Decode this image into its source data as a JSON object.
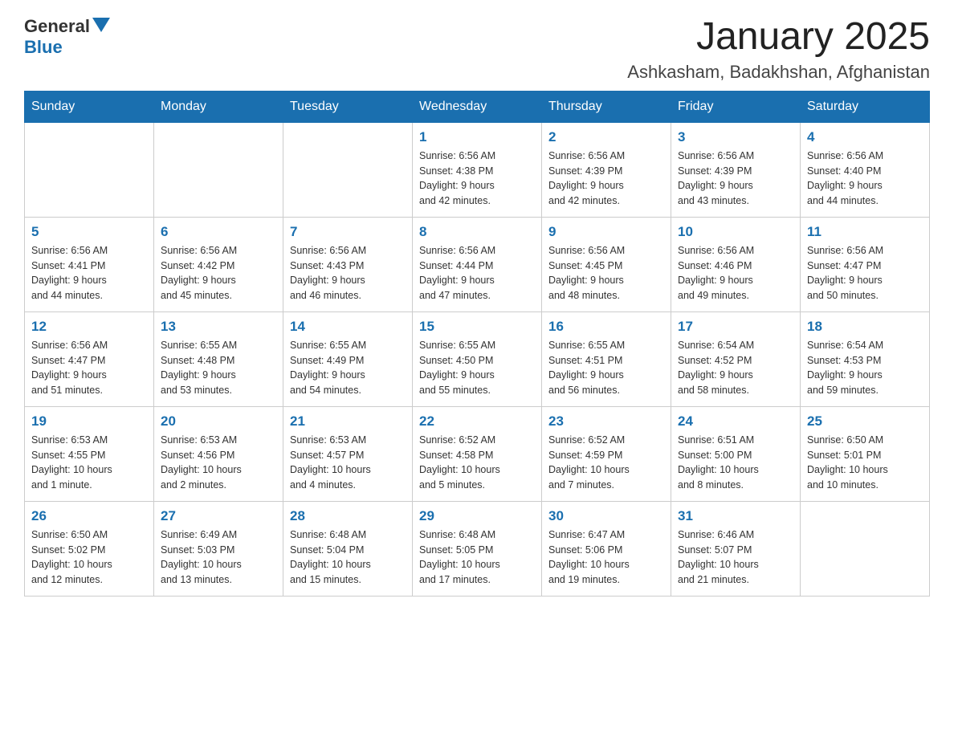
{
  "header": {
    "logo": {
      "general": "General",
      "blue": "Blue"
    },
    "title": "January 2025",
    "location": "Ashkasham, Badakhshan, Afghanistan"
  },
  "days_of_week": [
    "Sunday",
    "Monday",
    "Tuesday",
    "Wednesday",
    "Thursday",
    "Friday",
    "Saturday"
  ],
  "weeks": [
    [
      {
        "day": "",
        "info": ""
      },
      {
        "day": "",
        "info": ""
      },
      {
        "day": "",
        "info": ""
      },
      {
        "day": "1",
        "info": "Sunrise: 6:56 AM\nSunset: 4:38 PM\nDaylight: 9 hours\nand 42 minutes."
      },
      {
        "day": "2",
        "info": "Sunrise: 6:56 AM\nSunset: 4:39 PM\nDaylight: 9 hours\nand 42 minutes."
      },
      {
        "day": "3",
        "info": "Sunrise: 6:56 AM\nSunset: 4:39 PM\nDaylight: 9 hours\nand 43 minutes."
      },
      {
        "day": "4",
        "info": "Sunrise: 6:56 AM\nSunset: 4:40 PM\nDaylight: 9 hours\nand 44 minutes."
      }
    ],
    [
      {
        "day": "5",
        "info": "Sunrise: 6:56 AM\nSunset: 4:41 PM\nDaylight: 9 hours\nand 44 minutes."
      },
      {
        "day": "6",
        "info": "Sunrise: 6:56 AM\nSunset: 4:42 PM\nDaylight: 9 hours\nand 45 minutes."
      },
      {
        "day": "7",
        "info": "Sunrise: 6:56 AM\nSunset: 4:43 PM\nDaylight: 9 hours\nand 46 minutes."
      },
      {
        "day": "8",
        "info": "Sunrise: 6:56 AM\nSunset: 4:44 PM\nDaylight: 9 hours\nand 47 minutes."
      },
      {
        "day": "9",
        "info": "Sunrise: 6:56 AM\nSunset: 4:45 PM\nDaylight: 9 hours\nand 48 minutes."
      },
      {
        "day": "10",
        "info": "Sunrise: 6:56 AM\nSunset: 4:46 PM\nDaylight: 9 hours\nand 49 minutes."
      },
      {
        "day": "11",
        "info": "Sunrise: 6:56 AM\nSunset: 4:47 PM\nDaylight: 9 hours\nand 50 minutes."
      }
    ],
    [
      {
        "day": "12",
        "info": "Sunrise: 6:56 AM\nSunset: 4:47 PM\nDaylight: 9 hours\nand 51 minutes."
      },
      {
        "day": "13",
        "info": "Sunrise: 6:55 AM\nSunset: 4:48 PM\nDaylight: 9 hours\nand 53 minutes."
      },
      {
        "day": "14",
        "info": "Sunrise: 6:55 AM\nSunset: 4:49 PM\nDaylight: 9 hours\nand 54 minutes."
      },
      {
        "day": "15",
        "info": "Sunrise: 6:55 AM\nSunset: 4:50 PM\nDaylight: 9 hours\nand 55 minutes."
      },
      {
        "day": "16",
        "info": "Sunrise: 6:55 AM\nSunset: 4:51 PM\nDaylight: 9 hours\nand 56 minutes."
      },
      {
        "day": "17",
        "info": "Sunrise: 6:54 AM\nSunset: 4:52 PM\nDaylight: 9 hours\nand 58 minutes."
      },
      {
        "day": "18",
        "info": "Sunrise: 6:54 AM\nSunset: 4:53 PM\nDaylight: 9 hours\nand 59 minutes."
      }
    ],
    [
      {
        "day": "19",
        "info": "Sunrise: 6:53 AM\nSunset: 4:55 PM\nDaylight: 10 hours\nand 1 minute."
      },
      {
        "day": "20",
        "info": "Sunrise: 6:53 AM\nSunset: 4:56 PM\nDaylight: 10 hours\nand 2 minutes."
      },
      {
        "day": "21",
        "info": "Sunrise: 6:53 AM\nSunset: 4:57 PM\nDaylight: 10 hours\nand 4 minutes."
      },
      {
        "day": "22",
        "info": "Sunrise: 6:52 AM\nSunset: 4:58 PM\nDaylight: 10 hours\nand 5 minutes."
      },
      {
        "day": "23",
        "info": "Sunrise: 6:52 AM\nSunset: 4:59 PM\nDaylight: 10 hours\nand 7 minutes."
      },
      {
        "day": "24",
        "info": "Sunrise: 6:51 AM\nSunset: 5:00 PM\nDaylight: 10 hours\nand 8 minutes."
      },
      {
        "day": "25",
        "info": "Sunrise: 6:50 AM\nSunset: 5:01 PM\nDaylight: 10 hours\nand 10 minutes."
      }
    ],
    [
      {
        "day": "26",
        "info": "Sunrise: 6:50 AM\nSunset: 5:02 PM\nDaylight: 10 hours\nand 12 minutes."
      },
      {
        "day": "27",
        "info": "Sunrise: 6:49 AM\nSunset: 5:03 PM\nDaylight: 10 hours\nand 13 minutes."
      },
      {
        "day": "28",
        "info": "Sunrise: 6:48 AM\nSunset: 5:04 PM\nDaylight: 10 hours\nand 15 minutes."
      },
      {
        "day": "29",
        "info": "Sunrise: 6:48 AM\nSunset: 5:05 PM\nDaylight: 10 hours\nand 17 minutes."
      },
      {
        "day": "30",
        "info": "Sunrise: 6:47 AM\nSunset: 5:06 PM\nDaylight: 10 hours\nand 19 minutes."
      },
      {
        "day": "31",
        "info": "Sunrise: 6:46 AM\nSunset: 5:07 PM\nDaylight: 10 hours\nand 21 minutes."
      },
      {
        "day": "",
        "info": ""
      }
    ]
  ]
}
